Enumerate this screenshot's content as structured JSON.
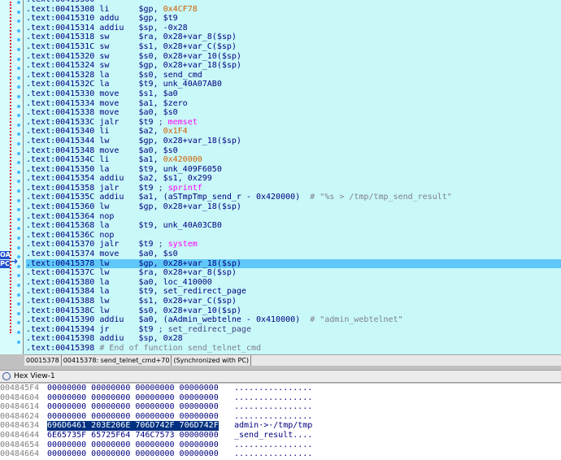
{
  "disasm": {
    "lines": [
      {
        "addr": ".text:00415300",
        "mn": "",
        "ops": [],
        "cmt": ""
      },
      {
        "addr": ".text:00415308",
        "mn": "li",
        "ops": [
          {
            "t": "$gp, "
          },
          {
            "t": "0x4CF78",
            "c": "imm"
          }
        ]
      },
      {
        "addr": ".text:00415310",
        "mn": "addu",
        "ops": [
          {
            "t": "$gp, $t9"
          }
        ]
      },
      {
        "addr": ".text:00415314",
        "mn": "addiu",
        "ops": [
          {
            "t": "$sp, -0x28"
          }
        ]
      },
      {
        "addr": ".text:00415318",
        "mn": "sw",
        "ops": [
          {
            "t": "$ra, 0x28+var_8($sp)"
          }
        ]
      },
      {
        "addr": ".text:0041531C",
        "mn": "sw",
        "ops": [
          {
            "t": "$s1, 0x28+var_C($sp)"
          }
        ]
      },
      {
        "addr": ".text:00415320",
        "mn": "sw",
        "ops": [
          {
            "t": "$s0, 0x28+var_10($sp)"
          }
        ]
      },
      {
        "addr": ".text:00415324",
        "mn": "sw",
        "ops": [
          {
            "t": "$gp, 0x28+var_18($sp)"
          }
        ]
      },
      {
        "addr": ".text:00415328",
        "mn": "la",
        "ops": [
          {
            "t": "$s0, send_cmd"
          }
        ]
      },
      {
        "addr": ".text:0041532C",
        "mn": "la",
        "ops": [
          {
            "t": "$t9, unk_40A07AB0"
          }
        ]
      },
      {
        "addr": ".text:00415330",
        "mn": "move",
        "ops": [
          {
            "t": "$s1, $a0"
          }
        ]
      },
      {
        "addr": ".text:00415334",
        "mn": "move",
        "ops": [
          {
            "t": "$a1, $zero"
          }
        ]
      },
      {
        "addr": ".text:00415338",
        "mn": "move",
        "ops": [
          {
            "t": "$a0, $s0"
          }
        ]
      },
      {
        "addr": ".text:0041533C",
        "mn": "jalr",
        "ops": [
          {
            "t": "$t9 "
          },
          {
            "t": "; ",
            "c": "cmt"
          },
          {
            "t": "memset",
            "c": "fn"
          }
        ]
      },
      {
        "addr": ".text:00415340",
        "mn": "li",
        "ops": [
          {
            "t": "$a2, "
          },
          {
            "t": "0x1F4",
            "c": "imm"
          }
        ]
      },
      {
        "addr": ".text:00415344",
        "mn": "lw",
        "ops": [
          {
            "t": "$gp, 0x28+var_18($sp)"
          }
        ]
      },
      {
        "addr": ".text:00415348",
        "mn": "move",
        "ops": [
          {
            "t": "$a0, $s0"
          }
        ]
      },
      {
        "addr": ".text:0041534C",
        "mn": "li",
        "ops": [
          {
            "t": "$a1, "
          },
          {
            "t": "0x420000",
            "c": "imm"
          }
        ]
      },
      {
        "addr": ".text:00415350",
        "mn": "la",
        "ops": [
          {
            "t": "$t9, unk_409F6050"
          }
        ]
      },
      {
        "addr": ".text:00415354",
        "mn": "addiu",
        "ops": [
          {
            "t": "$a2, $s1, 0x299"
          }
        ]
      },
      {
        "addr": ".text:00415358",
        "mn": "jalr",
        "ops": [
          {
            "t": "$t9 "
          },
          {
            "t": "; ",
            "c": "cmt"
          },
          {
            "t": "sprintf",
            "c": "fn"
          }
        ]
      },
      {
        "addr": ".text:0041535C",
        "mn": "addiu",
        "ops": [
          {
            "t": "$a1, (aSTmpTmp_send_r - 0x420000)  "
          },
          {
            "t": "# \"%s > /tmp/tmp_send_result\"",
            "c": "cmtr"
          }
        ]
      },
      {
        "addr": ".text:00415360",
        "mn": "lw",
        "ops": [
          {
            "t": "$gp, 0x28+var_18($sp)"
          }
        ]
      },
      {
        "addr": ".text:00415364",
        "mn": "nop",
        "ops": []
      },
      {
        "addr": ".text:00415368",
        "mn": "la",
        "ops": [
          {
            "t": "$t9, unk_40A03CB0"
          }
        ]
      },
      {
        "addr": ".text:0041536C",
        "mn": "nop",
        "ops": []
      },
      {
        "addr": ".text:00415370",
        "mn": "jalr",
        "ops": [
          {
            "t": "$t9 "
          },
          {
            "t": "; ",
            "c": "cmt"
          },
          {
            "t": "system",
            "c": "fn"
          }
        ]
      },
      {
        "addr": ".text:00415374",
        "mn": "move",
        "ops": [
          {
            "t": "$a0, $s0"
          }
        ]
      },
      {
        "addr": ".text:00415378",
        "mn": "lw",
        "ops": [
          {
            "t": "$gp, 0x28+var_18($sp)"
          }
        ],
        "current": true
      },
      {
        "addr": ".text:0041537C",
        "mn": "lw",
        "ops": [
          {
            "t": "$ra, 0x28+var_8($sp)"
          }
        ]
      },
      {
        "addr": ".text:00415380",
        "mn": "la",
        "ops": [
          {
            "t": "$a0, loc_410000"
          }
        ]
      },
      {
        "addr": ".text:00415384",
        "mn": "la",
        "ops": [
          {
            "t": "$t9, set_redirect_page"
          }
        ]
      },
      {
        "addr": ".text:00415388",
        "mn": "lw",
        "ops": [
          {
            "t": "$s1, 0x28+var_C($sp)"
          }
        ]
      },
      {
        "addr": ".text:0041538C",
        "mn": "lw",
        "ops": [
          {
            "t": "$s0, 0x28+var_10($sp)"
          }
        ]
      },
      {
        "addr": ".text:00415390",
        "mn": "addiu",
        "ops": [
          {
            "t": "$a0, (aAdmin_webtelne - 0x410000)  "
          },
          {
            "t": "# \"admin_webtelnet\"",
            "c": "cmtr"
          }
        ]
      },
      {
        "addr": ".text:00415394",
        "mn": "jr",
        "ops": [
          {
            "t": "$t9 "
          },
          {
            "t": "; ",
            "c": "cmt"
          },
          {
            "t": "set_redirect_page",
            "c": "cmt"
          }
        ]
      },
      {
        "addr": ".text:00415398",
        "mn": "addiu",
        "ops": [
          {
            "t": "$sp, 0x28"
          }
        ]
      },
      {
        "addr": ".text:00415398",
        "mn": "",
        "ops": [
          {
            "t": " # End of function send_telnet_cmd",
            "c": "cmtr"
          }
        ]
      }
    ],
    "pc_labels": [
      "OA",
      "PC"
    ]
  },
  "statusbar": {
    "offset": "00015378",
    "location": "00415378: send_telnet_cmd+70",
    "sync": "(Synchronized with PC)"
  },
  "hexview": {
    "title": "Hex View-1",
    "rows": [
      {
        "addr": "004845F4",
        "bytes": "00000000 00000000 00000000 00000000",
        "ascii": "................"
      },
      {
        "addr": "00484604",
        "bytes": "00000000 00000000 00000000 00000000",
        "ascii": "................"
      },
      {
        "addr": "00484614",
        "bytes": "00000000 00000000 00000000 00000000",
        "ascii": "................"
      },
      {
        "addr": "00484624",
        "bytes": "00000000 00000000 00000000 00000000",
        "ascii": "................"
      },
      {
        "addr": "00484634",
        "bytes": "696D6461 203E206E 706D742F 706D742F",
        "ascii": "admin·>·/tmp/tmp",
        "selected": true
      },
      {
        "addr": "00484644",
        "bytes": "6E65735F 65725F64 746C7573 00000000",
        "ascii": "_send_result...."
      },
      {
        "addr": "00484654",
        "bytes": "00000000 00000000 00000000 00000000",
        "ascii": "................"
      },
      {
        "addr": "00484664",
        "bytes": "00000000 00000000 00000000 00000000",
        "ascii": "................"
      }
    ]
  }
}
